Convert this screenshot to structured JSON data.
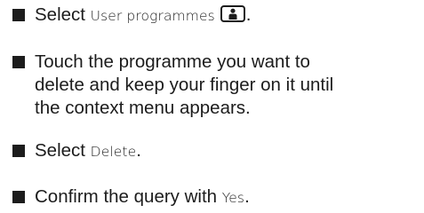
{
  "steps": [
    {
      "before": "Select ",
      "ui_term": "User programmes",
      "icon": "user-icon",
      "after": "."
    },
    {
      "lines": [
        "Touch the programme you want to",
        "delete and keep your finger on it until",
        "the context menu appears."
      ]
    },
    {
      "before": "Select ",
      "ui_term": "Delete",
      "after": "."
    },
    {
      "before": "Confirm the query with ",
      "ui_term": "Yes",
      "after": "."
    }
  ]
}
